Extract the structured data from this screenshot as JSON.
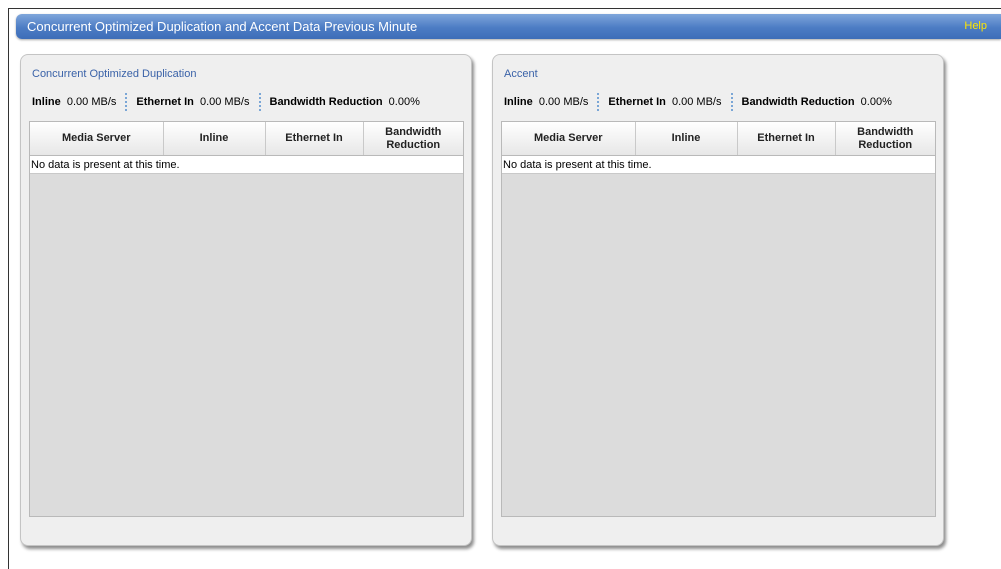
{
  "header": {
    "title": "Concurrent Optimized Duplication and Accent Data Previous Minute",
    "help_label": "Help"
  },
  "panels": [
    {
      "title": "Concurrent Optimized Duplication",
      "stats": [
        {
          "label": "Inline",
          "value": "0.00 MB/s"
        },
        {
          "label": "Ethernet In",
          "value": "0.00 MB/s"
        },
        {
          "label": "Bandwidth Reduction",
          "value": "0.00%"
        }
      ],
      "columns": [
        "Media Server",
        "Inline",
        "Ethernet In",
        "Bandwidth Reduction"
      ],
      "empty_message": "No data is present at this time."
    },
    {
      "title": "Accent",
      "stats": [
        {
          "label": "Inline",
          "value": "0.00 MB/s"
        },
        {
          "label": "Ethernet In",
          "value": "0.00 MB/s"
        },
        {
          "label": "Bandwidth Reduction",
          "value": "0.00%"
        }
      ],
      "columns": [
        "Media Server",
        "Inline",
        "Ethernet In",
        "Bandwidth Reduction"
      ],
      "empty_message": "No data is present at this time."
    }
  ]
}
